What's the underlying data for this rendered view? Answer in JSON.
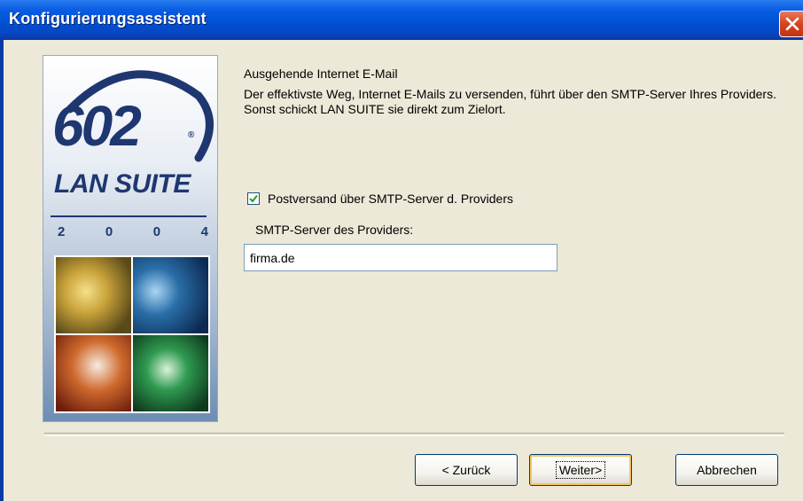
{
  "window": {
    "title": "Konfigurierungsassistent",
    "colors": {
      "titlebar": "#0a5de3",
      "face": "#ece9d8",
      "logo": "#1f3770"
    },
    "close_icon": "close-icon"
  },
  "banner": {
    "logo_number": "602",
    "registered": "®",
    "product": "LAN SUITE",
    "year_digits": [
      "2",
      "0",
      "0",
      "4"
    ]
  },
  "content": {
    "heading": "Ausgehende Internet E-Mail",
    "description": "Der effektivste Weg, Internet E-Mails zu versenden, führt über den SMTP-Server Ihres Providers. Sonst schickt LAN SUITE sie direkt zum Zielort.",
    "checkbox": {
      "label": "Postversand über SMTP-Server d. Providers",
      "checked": true
    },
    "server_label": "SMTP-Server des Providers:",
    "server_value": "firma.de"
  },
  "buttons": {
    "back": "< Zurück",
    "next": "Weiter>",
    "cancel": "Abbrechen"
  }
}
